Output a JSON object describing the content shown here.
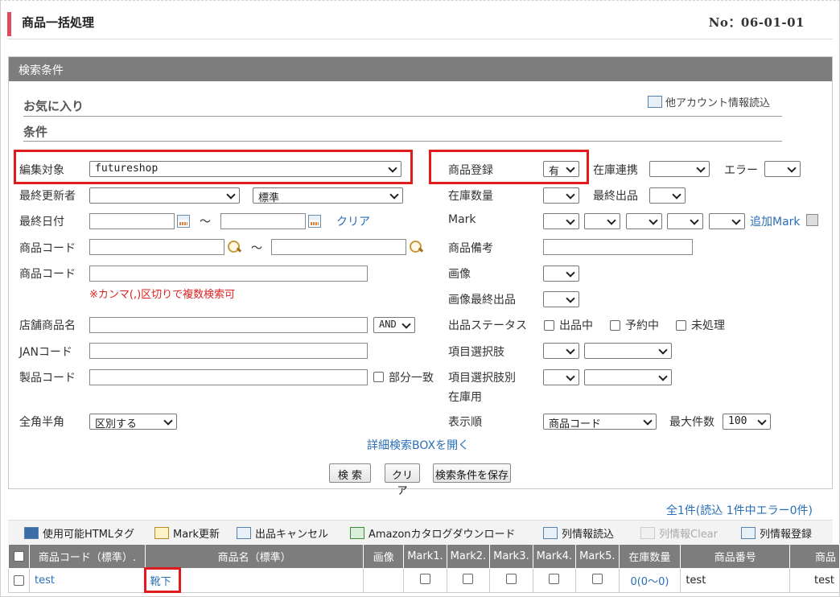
{
  "header": {
    "title": "商品一括処理",
    "no": "No：06-01-01"
  },
  "panel": {
    "title": "検索条件",
    "favorites": "お気に入り",
    "conditions": "条件",
    "other_account": "他アカウント情報読込"
  },
  "form": {
    "edit_target_label": "編集対象",
    "edit_target_value": "futureshop",
    "last_updater_label": "最終更新者",
    "last_updater_value": "",
    "standard_value": "標準",
    "last_date_label": "最終日付",
    "tilde": "～",
    "clear_link": "クリア",
    "product_code_label": "商品コード",
    "product_code2_label": "商品コード",
    "comma_note": "※カンマ(,)区切りで複数検索可",
    "store_product_label": "店舗商品名",
    "and_value": "AND",
    "jan_label": "JANコード",
    "maker_code_label": "製品コード",
    "partial_match": "部分一致",
    "zenkaku_label": "全角半角",
    "zenkaku_value": "区別する",
    "registered_label": "商品登録",
    "registered_value": "有",
    "stock_link_label": "在庫連携",
    "error_label": "エラー",
    "stock_qty_label": "在庫数量",
    "last_listing_label": "最終出品",
    "mark_label": "Mark",
    "add_mark_link": "追加Mark",
    "remarks_label": "商品備考",
    "image_label": "画像",
    "image_last_label": "画像最終出品",
    "listing_status_label": "出品ステータス",
    "status_listing": "出品中",
    "status_reserved": "予約中",
    "status_unprocessed": "未処理",
    "item_choice_label": "項目選択肢",
    "item_choice_stock_label1": "項目選択肢別",
    "item_choice_stock_label2": "在庫用",
    "sort_label": "表示順",
    "sort_value": "商品コード",
    "max_count_label": "最大件数",
    "max_count_value": "100",
    "detail_box_link": "詳細検索BOXを開く",
    "search_button": "検 索",
    "clear_button": "クリア",
    "save_button": "検索条件を保存"
  },
  "result_count": "全1件(読込 1件中エラー0件)",
  "toolbar": {
    "html_tags": "使用可能HTMLタグ",
    "mark_update": "Mark更新",
    "cancel_listing": "出品キャンセル",
    "amazon_download": "Amazonカタログダウンロード",
    "col_read": "列情報読込",
    "col_clear": "列情報Clear",
    "col_register": "列情報登録"
  },
  "table": {
    "headers": [
      "商品コード（標準）.",
      "商品名（標準）",
      "画像",
      "Mark1.",
      "Mark2.",
      "Mark3.",
      "Mark4.",
      "Mark5.",
      "在庫数量",
      "商品番号",
      "商品"
    ],
    "row": {
      "code": "test",
      "name": "靴下",
      "stock": "0(0～0)",
      "number": "test",
      "product": "test"
    }
  }
}
